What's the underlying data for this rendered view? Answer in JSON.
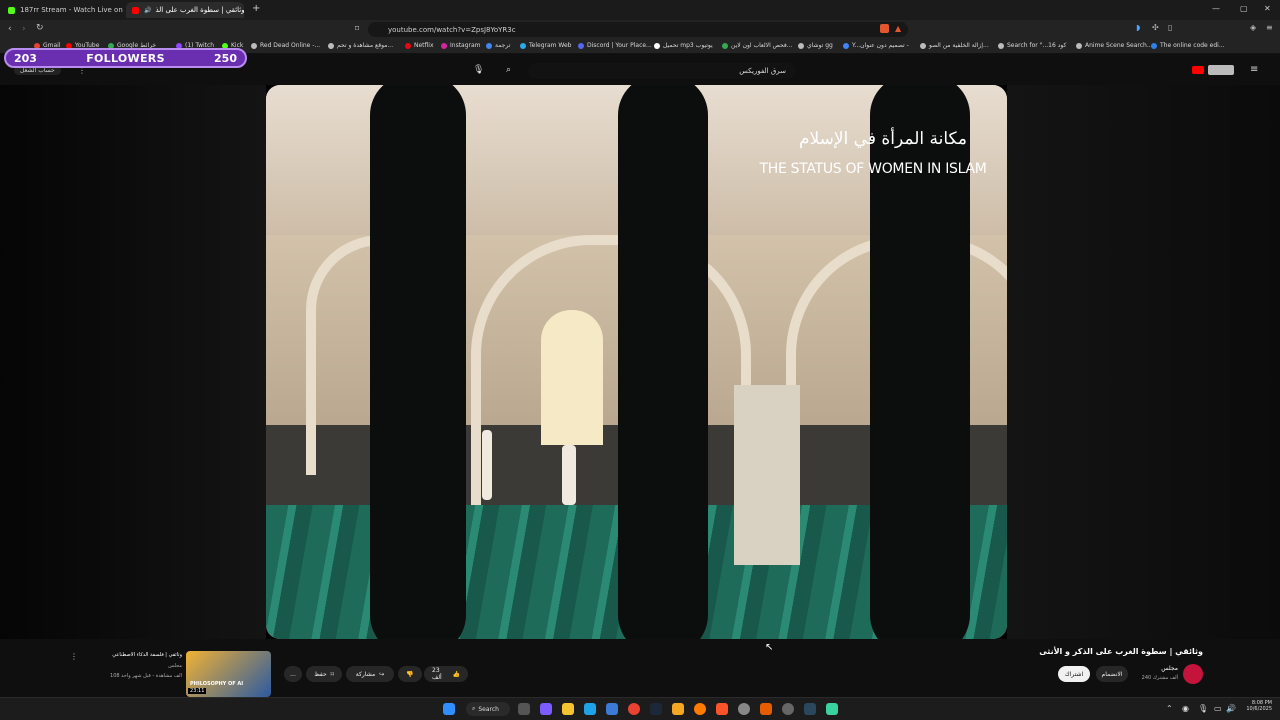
{
  "browser": {
    "tabs": [
      {
        "label": "187rr Stream - Watch Live on Kick",
        "color": "#53fc18"
      },
      {
        "label": "وثائقي | سطوة الغرب على الذ...",
        "color": "#ff0000"
      }
    ],
    "new_tab_label": "+",
    "url": "youtube.com/watch?v=ZpsJ8YoYR3c",
    "bookmarks": [
      "Gmail",
      "YouTube",
      "Google خرائط",
      "(1) Twitch",
      "Kick",
      "Red Dead Online -...",
      "موقع مشاهدة و تحم...",
      "Netflix",
      "Instagram",
      "ترجمة",
      "Telegram Web",
      "Discord | Your Place...",
      "تحميل mp3 يوتيوب",
      "فحص الالعاب اون لاين...",
      "توشاي gg",
      "Y...تصميم دون عنوان -",
      "إزالة الخلفية من الصو...",
      "Search for \"...كود 16",
      "Anime Scene Search...",
      "The online code edi..."
    ]
  },
  "overlay": {
    "left_count": "203",
    "label": "FOLLOWERS",
    "right_count": "250"
  },
  "youtube": {
    "search_value": "سرق الفوريكس",
    "voice_icon": "mic-icon",
    "left_label": "حساب الشغل"
  },
  "video": {
    "title_ar": "مكانة المرأة في الإسلام",
    "title_en": "THE STATUS OF WOMEN IN ISLAM"
  },
  "info": {
    "title": "وثائقي | سطوة الغرب على الذكر و الأنثى",
    "channel": "مجلس",
    "subscribers": "240 ألف مشترك",
    "subscribe_label": "اشتراك",
    "join_label": "الانضمام",
    "likes": "23 ألف",
    "share_label": "مشاركة",
    "save_label": "حفظ",
    "more_label": "..."
  },
  "next_video": {
    "title": "وثائقي | فلسفة الذكاء الاصطناعي",
    "channel": "مجلس",
    "meta": "108 ألف مشاهدة - قبل شهر واحد",
    "duration": "23:11",
    "thumb_text": "PHILOSOPHY OF AI"
  },
  "taskbar": {
    "search_label": "Search",
    "time": "8:08 PM",
    "date": "10/6/2025"
  }
}
